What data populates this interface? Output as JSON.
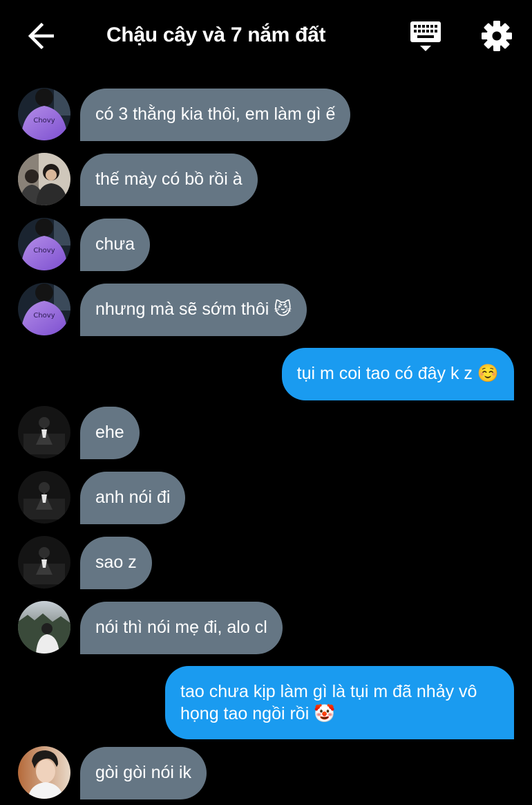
{
  "header": {
    "title": "Chậu cây và 7 nắm đất",
    "back_icon": "arrow-left-icon",
    "keyboard_icon": "keyboard-icon",
    "settings_icon": "gear-icon"
  },
  "colors": {
    "background": "#000000",
    "incoming_bubble": "#657684",
    "outgoing_bubble": "#1a9bf0",
    "text": "#ffffff"
  },
  "messages": [
    {
      "direction": "in",
      "avatar": "chovy-purple-avatar",
      "text": "có 3 thằng kia thôi, em làm gì ế"
    },
    {
      "direction": "in",
      "avatar": "two-people-avatar",
      "text": "thế mày có bồ rồi à"
    },
    {
      "direction": "in",
      "avatar": "chovy-purple-avatar",
      "text": "chưa"
    },
    {
      "direction": "in",
      "avatar": "chovy-purple-avatar",
      "text": "nhưng mà sẽ sớm thôi 😼"
    },
    {
      "direction": "out",
      "text": "tụi m coi tao có đây k z ☺️"
    },
    {
      "direction": "in",
      "avatar": "dark-figure-avatar",
      "text": "ehe"
    },
    {
      "direction": "in",
      "avatar": "dark-figure-avatar",
      "text": "anh nói đi"
    },
    {
      "direction": "in",
      "avatar": "dark-figure-avatar",
      "text": "sao z"
    },
    {
      "direction": "in",
      "avatar": "outdoor-person-avatar",
      "text": "nói thì nói mẹ đi, alo cl"
    },
    {
      "direction": "out",
      "text": "tao chưa kịp làm gì là tụi m đã nhảy vô họng tao ngồi rồi 🤡"
    },
    {
      "direction": "in",
      "avatar": "young-man-avatar",
      "text": "gòi gòi nói ik"
    }
  ]
}
